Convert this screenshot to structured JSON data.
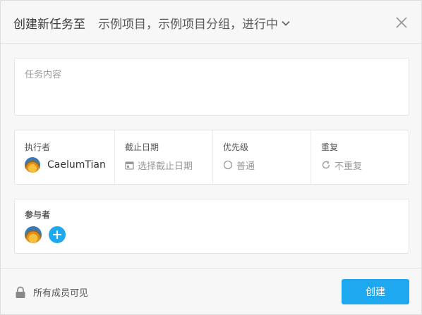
{
  "header": {
    "title": "创建新任务至",
    "target": "示例项目，示例项目分组，进行中"
  },
  "content": {
    "placeholder": "任务内容"
  },
  "fields": {
    "assignee": {
      "label": "执行者",
      "value": "CaelumTian"
    },
    "due_date": {
      "label": "截止日期",
      "value": "选择截止日期"
    },
    "priority": {
      "label": "优先级",
      "value": "普通"
    },
    "repeat": {
      "label": "重复",
      "value": "不重复"
    }
  },
  "participants": {
    "label": "参与者"
  },
  "footer": {
    "visibility": "所有成员可见",
    "create_label": "创建"
  },
  "colors": {
    "accent": "#1da8f0",
    "background": "#f7f7f7"
  }
}
